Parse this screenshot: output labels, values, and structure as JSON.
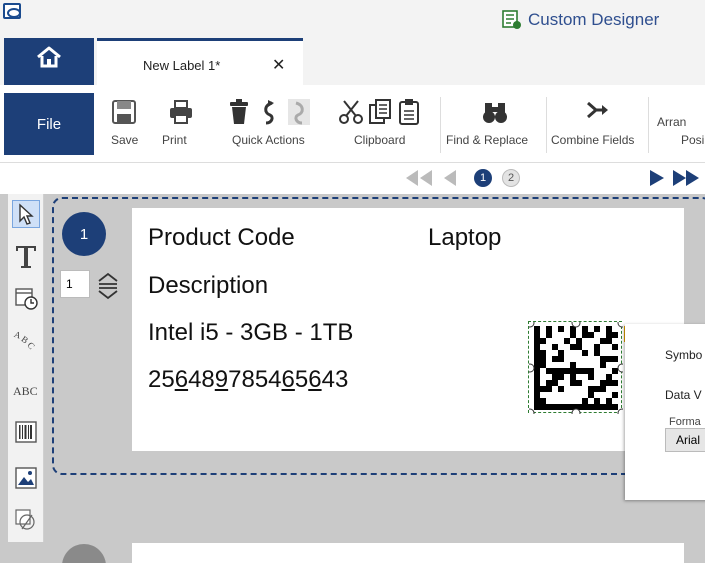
{
  "app": {
    "title": "Custom Designer"
  },
  "tabs": {
    "home_label": "Home",
    "document_tab": "New Label 1*",
    "close_symbol": "✕"
  },
  "ribbon": {
    "file_label": "File",
    "save_label": "Save",
    "print_label": "Print",
    "quick_actions_label": "Quick Actions",
    "clipboard_label": "Clipboard",
    "find_replace_label": "Find & Replace",
    "combine_fields_label": "Combine Fields",
    "arrange_label": "Arran",
    "position_label": "Posi"
  },
  "pager": {
    "page1": "1",
    "page2": "2"
  },
  "label": {
    "badge_number": "1",
    "quantity": "1",
    "product_code_label": "Product Code",
    "product_code_value": "Laptop",
    "description_label": "Description",
    "description_value": "Intel i5 - 3GB - 1TB",
    "barcode_digits": [
      {
        "t": "25",
        "u": false
      },
      {
        "t": "6",
        "u": true
      },
      {
        "t": "48",
        "u": false
      },
      {
        "t": "9",
        "u": true
      },
      {
        "t": "7854",
        "u": false
      },
      {
        "t": "6",
        "u": true
      },
      {
        "t": "5",
        "u": false
      },
      {
        "t": "6",
        "u": true
      },
      {
        "t": "43",
        "u": false
      }
    ]
  },
  "properties": {
    "symbology_label": "Symbo",
    "data_value_label": "Data V",
    "format_label": "Forma",
    "font_value": "Arial"
  },
  "colors": {
    "brand": "#1d3f78",
    "accent_warning": "#e6a400"
  }
}
